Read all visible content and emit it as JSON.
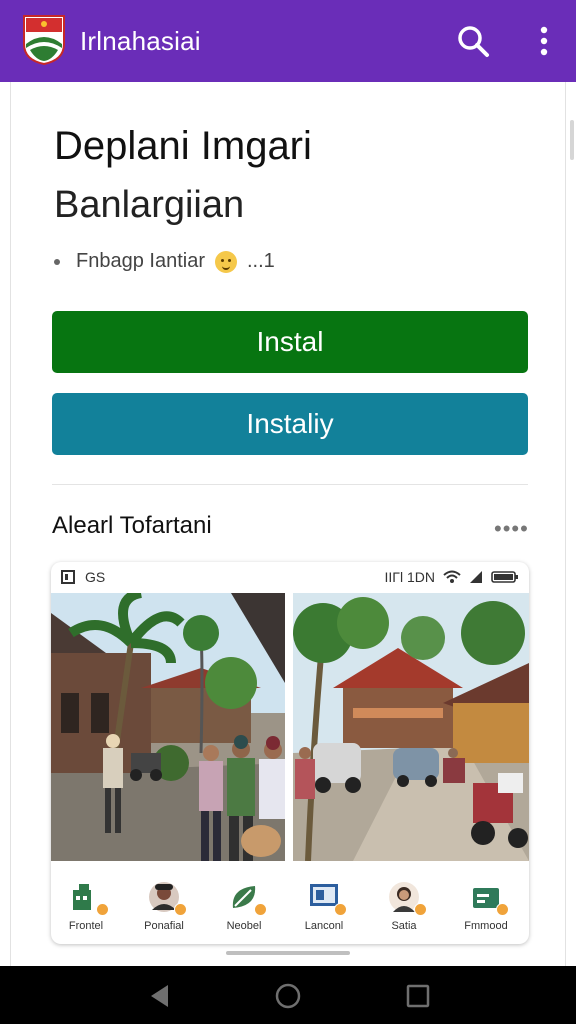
{
  "appbar": {
    "title": "Irlnahasiai",
    "icons": {
      "logo": "flag-shield-logo",
      "search": "search-icon",
      "more": "more-vert-icon"
    },
    "color": "#6a2db8"
  },
  "listing": {
    "title": "Deplani Imgari",
    "subtitle": "Banlargiian",
    "meta_text": "Fnbagp Iantiar",
    "meta_suffix": "...1"
  },
  "buttons": {
    "install": "Instal",
    "install_secondary": "Instaliy",
    "install_color": "#077511",
    "install_secondary_color": "#12819a"
  },
  "section": {
    "title": "Alearl Tofartani",
    "more": "••••"
  },
  "screenshot": {
    "status_left": "GS",
    "status_right": "IIΓl 1DN",
    "apps": [
      {
        "label": "Frontel",
        "icon": "building-icon"
      },
      {
        "label": "Ponafial",
        "icon": "avatar-icon"
      },
      {
        "label": "Neobel",
        "icon": "leaf-icon"
      },
      {
        "label": "Lanconl",
        "icon": "board-icon"
      },
      {
        "label": "Satia",
        "icon": "person-icon"
      },
      {
        "label": "Fmmood",
        "icon": "card-icon"
      }
    ]
  },
  "system_nav": {
    "back": "back-icon",
    "home": "home-icon",
    "recent": "recent-apps-icon"
  }
}
